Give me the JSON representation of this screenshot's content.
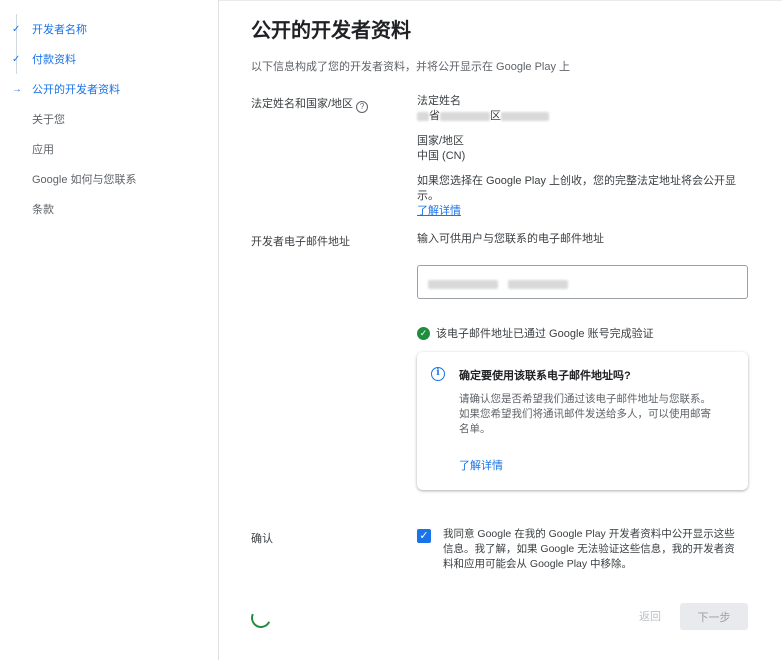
{
  "sidebar": {
    "items": [
      {
        "label": "开发者名称",
        "mark": "✓"
      },
      {
        "label": "付款资料",
        "mark": "✓"
      },
      {
        "label": "公开的开发者资料",
        "mark": "→"
      },
      {
        "label": "关于您",
        "mark": ""
      },
      {
        "label": "应用",
        "mark": ""
      },
      {
        "label": "Google 如何与您联系",
        "mark": ""
      },
      {
        "label": "条款",
        "mark": ""
      }
    ]
  },
  "page": {
    "title": "公开的开发者资料",
    "subtitle": "以下信息构成了您的开发者资料，并将公开显示在 Google Play 上"
  },
  "legal": {
    "label": "法定姓名和国家/地区",
    "help_icon": "?",
    "name_heading": "法定姓名",
    "address_parts": [
      "省",
      "区"
    ],
    "country_heading": "国家/地区",
    "country_value": "中国 (CN)",
    "note": "如果您选择在 Google Play 上创收，您的完整法定地址将会公开显示。",
    "learn_more": "了解详情"
  },
  "email": {
    "label": "开发者电子邮件地址",
    "prompt": "输入可供用户与您联系的电子邮件地址",
    "verified_text": "该电子邮件地址已通过 Google 账号完成验证",
    "verified_icon": "✓"
  },
  "info_card": {
    "icon": "i",
    "title": "确定要使用该联系电子邮件地址吗?",
    "body": "请确认您是否希望我们通过该电子邮件地址与您联系。如果您希望我们将通讯邮件发送给多人，可以使用邮寄名单。",
    "learn_more": "了解详情"
  },
  "confirm": {
    "label": "确认",
    "checkbox_mark": "✓",
    "text": "我同意 Google 在我的 Google Play 开发者资料中公开显示这些信息。我了解，如果 Google 无法验证这些信息，我的开发者资料和应用可能会从 Google Play 中移除。"
  },
  "footer": {
    "back_label": "返回",
    "next_label": "下一步"
  },
  "colors": {
    "accent": "#1a73e8",
    "success": "#1e8e3e",
    "disabled_bg": "#e8eaed"
  }
}
